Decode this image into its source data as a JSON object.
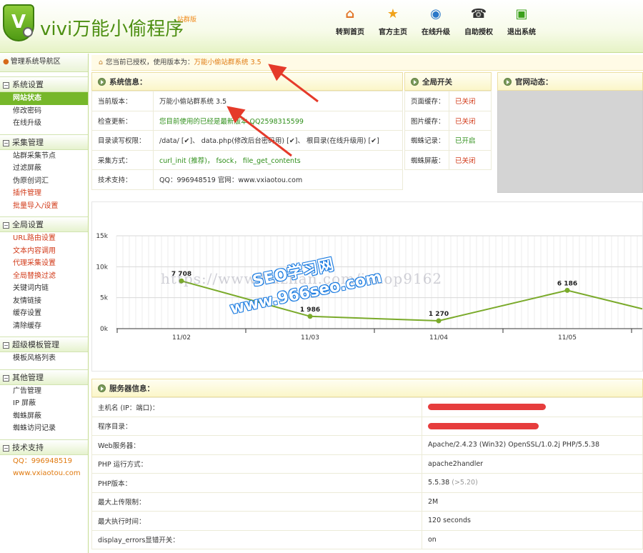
{
  "header": {
    "logo_letter": "V",
    "title": "vivi万能小偷程序",
    "edition": "站群版",
    "nav": [
      {
        "label": "转到首页",
        "icon": "home-icon",
        "glyph": "⌂",
        "color": "#e2762a"
      },
      {
        "label": "官方主页",
        "icon": "star-icon",
        "glyph": "★",
        "color": "#f0a21a"
      },
      {
        "label": "在线升级",
        "icon": "globe-icon",
        "glyph": "◉",
        "color": "#2a78c8"
      },
      {
        "label": "自助授权",
        "icon": "phone-icon",
        "glyph": "☎",
        "color": "#333333"
      },
      {
        "label": "退出系统",
        "icon": "rss-icon",
        "glyph": "▣",
        "color": "#3aa01a"
      }
    ]
  },
  "sidebar": {
    "title": "管理系统导航区",
    "groups": [
      {
        "label": "系统设置",
        "items": [
          {
            "label": "网站状态",
            "style": "active"
          },
          {
            "label": "修改密码",
            "style": ""
          },
          {
            "label": "在线升级",
            "style": ""
          }
        ]
      },
      {
        "label": "采集管理",
        "items": [
          {
            "label": "站群采集节点",
            "style": ""
          },
          {
            "label": "过滤屏蔽",
            "style": ""
          },
          {
            "label": "伪原创词汇",
            "style": ""
          },
          {
            "label": "插件管理",
            "style": "red"
          },
          {
            "label": "批量导入/设置",
            "style": "red"
          }
        ]
      },
      {
        "label": "全局设置",
        "items": [
          {
            "label": "URL路由设置",
            "style": "red"
          },
          {
            "label": "文本内容调用",
            "style": "red"
          },
          {
            "label": "代理采集设置",
            "style": "red"
          },
          {
            "label": "全局替换过滤",
            "style": "red"
          },
          {
            "label": "关键词内链",
            "style": ""
          },
          {
            "label": "友情链接",
            "style": ""
          },
          {
            "label": "缓存设置",
            "style": ""
          },
          {
            "label": "清除缓存",
            "style": ""
          }
        ]
      },
      {
        "label": "超级模板管理",
        "items": [
          {
            "label": "模板风格列表",
            "style": ""
          }
        ]
      },
      {
        "label": "其他管理",
        "items": [
          {
            "label": "广告管理",
            "style": ""
          },
          {
            "label": "IP 屏蔽",
            "style": ""
          },
          {
            "label": "蜘蛛屏蔽",
            "style": ""
          },
          {
            "label": "蜘蛛访问记录",
            "style": ""
          }
        ]
      },
      {
        "label": "技术支持",
        "items": [
          {
            "label": "QQ：996948519",
            "style": "orange"
          },
          {
            "label": "www.vxiaotou.com",
            "style": "orange"
          }
        ]
      }
    ]
  },
  "notice": {
    "text": "您当前已授权，使用版本为：",
    "version": "万能小偷站群系统 3.5"
  },
  "sys_info": {
    "title": "系统信息：",
    "rows": [
      {
        "k": "当前版本：",
        "v": "万能小偷站群系统 3.5"
      },
      {
        "k": "检查更新：",
        "v": "您目前使用的已经是最新版本 QQ2598315599"
      },
      {
        "k": "目录读写权限：",
        "v": "/data/ [✔]、 data.php(修改后台密码用) [✔]、 根目录(在线升级用) [✔]"
      },
      {
        "k": "采集方式：",
        "v": "curl_init (推荐)， fsock， file_get_contents"
      },
      {
        "k": "技术支持：",
        "v": "QQ：996948519    官网：www.vxiaotou.com"
      }
    ]
  },
  "global_switch": {
    "title": "全局开关",
    "rows": [
      {
        "k": "页面缓存：",
        "v": "已关闭",
        "state": "off"
      },
      {
        "k": "图片缓存：",
        "v": "已关闭",
        "state": "off"
      },
      {
        "k": "蜘蛛记录：",
        "v": "已开启",
        "state": "on"
      },
      {
        "k": "蜘蛛屏蔽：",
        "v": "已关闭",
        "state": "off"
      }
    ]
  },
  "news": {
    "title": "官网动态："
  },
  "chart_data": {
    "type": "line",
    "categories": [
      "11/02",
      "11/03",
      "11/04",
      "11/05"
    ],
    "values": [
      7708,
      1986,
      1270,
      6186
    ],
    "value_labels": [
      "7 708",
      "1 986",
      "1 270",
      "6 186"
    ],
    "y_ticks": [
      "0k",
      "5k",
      "10k",
      "15k"
    ],
    "ylim": [
      0,
      15000
    ],
    "grid": true,
    "line_color": "#7aaa2a"
  },
  "watermark": {
    "url": "https://www.huzhan.com/ishop9162",
    "seo": "SEO学习网",
    "site": "www.966seo.com"
  },
  "server": {
    "title": "服务器信息：",
    "rows": [
      {
        "k": "主机名 (IP：端口)：",
        "v": "",
        "redacted": true
      },
      {
        "k": "程序目录：",
        "v": "",
        "redacted": true
      },
      {
        "k": "Web服务器：",
        "v": "Apache/2.4.23 (Win32) OpenSSL/1.0.2j PHP/5.5.38"
      },
      {
        "k": "PHP 运行方式：",
        "v": "apache2handler"
      },
      {
        "k": "PHP版本：",
        "v": "5.5.38",
        "note": "(>5.20)"
      },
      {
        "k": "最大上传限制：",
        "v": "2M"
      },
      {
        "k": "最大执行时间：",
        "v": "120 seconds"
      },
      {
        "k": "display_errors显错开关：",
        "v": "on"
      }
    ]
  }
}
